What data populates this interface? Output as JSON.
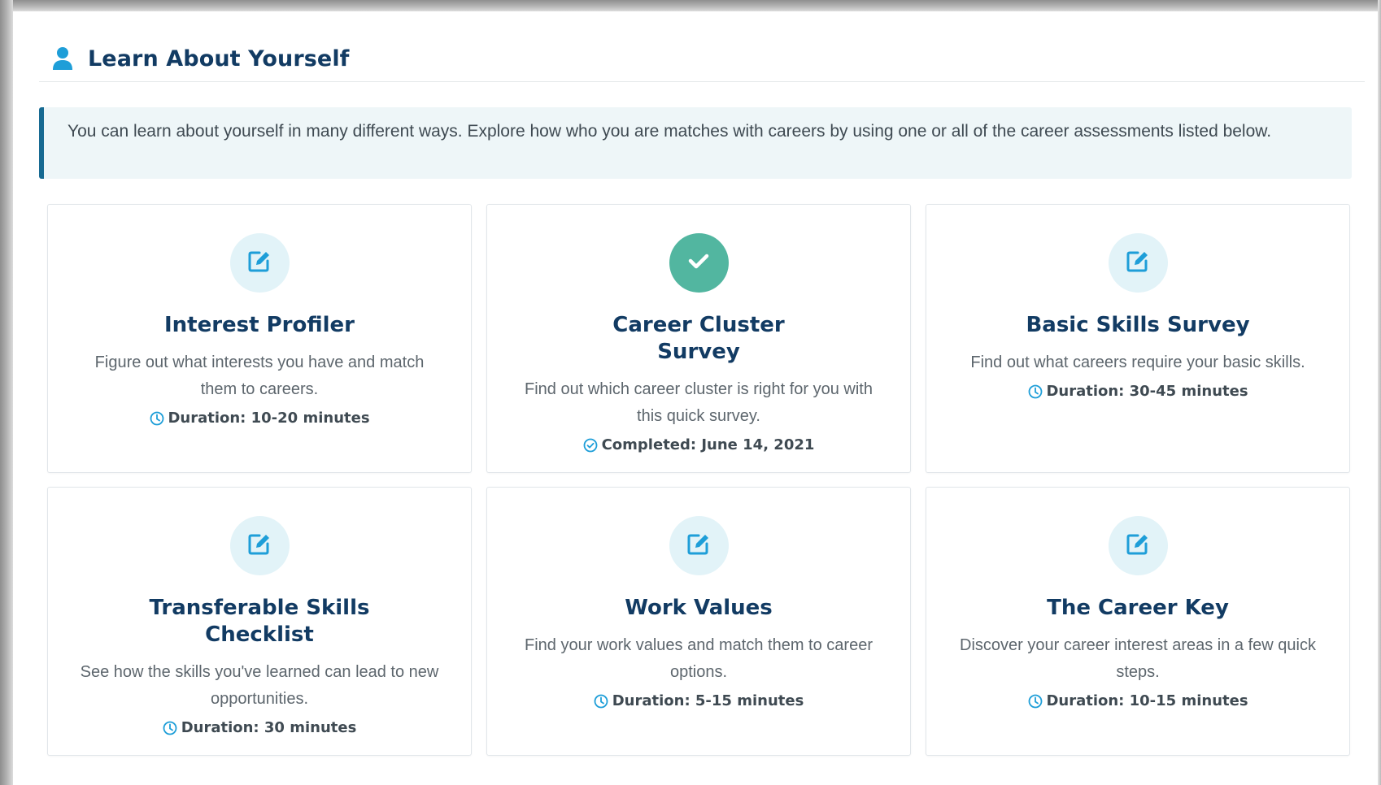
{
  "section": {
    "title": "Learn About Yourself",
    "icon": "user-icon",
    "intro": "You can learn about yourself in many different ways. Explore how who you are matches with careers by using one or all of the career assessments listed below."
  },
  "colors": {
    "heading": "#123b63",
    "accent": "#176a92",
    "icon_blue": "#1e9ed8",
    "completed_green": "#52b6a0",
    "intro_background": "#eef6f8"
  },
  "assessments": [
    {
      "title": "Interest Profiler",
      "description": "Figure out what interests you have and match them to careers.",
      "status": "pending",
      "icon": "edit-icon",
      "meta_icon": "clock-icon",
      "meta": "Duration: 10-20 minutes"
    },
    {
      "title": "Career Cluster Survey",
      "description": "Find out which career cluster is right for you with this quick survey.",
      "status": "completed",
      "icon": "check-icon",
      "meta_icon": "check-circle-icon",
      "meta": "Completed: June 14, 2021"
    },
    {
      "title": "Basic Skills Survey",
      "description": "Find out what careers require your basic skills.",
      "status": "pending",
      "icon": "edit-icon",
      "meta_icon": "clock-icon",
      "meta": "Duration: 30-45 minutes"
    },
    {
      "title": "Transferable Skills Checklist",
      "description": "See how the skills you've learned can lead to new opportunities.",
      "status": "pending",
      "icon": "edit-icon",
      "meta_icon": "clock-icon",
      "meta": "Duration: 30 minutes"
    },
    {
      "title": "Work Values",
      "description": "Find your work values and match them to career options.",
      "status": "pending",
      "icon": "edit-icon",
      "meta_icon": "clock-icon",
      "meta": "Duration: 5-15 minutes"
    },
    {
      "title": "The Career Key",
      "description": "Discover your career interest areas in a few quick steps.",
      "status": "pending",
      "icon": "edit-icon",
      "meta_icon": "clock-icon",
      "meta": "Duration: 10-15 minutes"
    }
  ]
}
